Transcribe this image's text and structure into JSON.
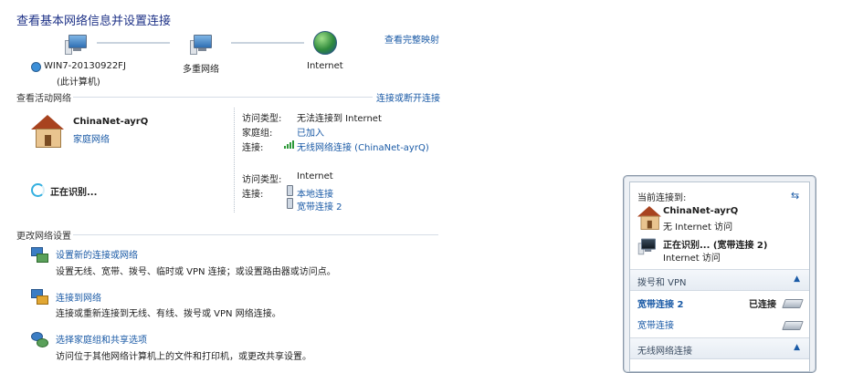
{
  "header": {
    "title": "查看基本网络信息并设置连接",
    "full_map_link": "查看完整映射"
  },
  "map": {
    "computer_name": "WIN7-20130922FJ",
    "computer_sub": "(此计算机)",
    "middle_label": "多重网络",
    "right_label": "Internet"
  },
  "active": {
    "section_title": "查看活动网络",
    "connect_link": "连接或断开连接",
    "net1": {
      "name": "ChinaNet-ayrQ",
      "type": "家庭网络",
      "rows": [
        {
          "label": "访问类型:",
          "value": "无法连接到 Internet"
        },
        {
          "label": "家庭组:",
          "value": "已加入"
        },
        {
          "label": "连接:",
          "value": "无线网络连接 (ChinaNet-ayrQ)"
        }
      ]
    },
    "net2": {
      "name": "正在识别...",
      "rows": [
        {
          "label": "访问类型:",
          "value": "Internet"
        },
        {
          "label": "连接:",
          "value": "本地连接"
        },
        {
          "label": "",
          "value": "宽带连接 2"
        }
      ]
    }
  },
  "settings": {
    "section_title": "更改网络设置",
    "items": [
      {
        "title": "设置新的连接或网络",
        "desc": "设置无线、宽带、拨号、临时或 VPN 连接；或设置路由器或访问点。"
      },
      {
        "title": "连接到网络",
        "desc": "连接或重新连接到无线、有线、拨号或 VPN 网络连接。"
      },
      {
        "title": "选择家庭组和共享选项",
        "desc": "访问位于其他网络计算机上的文件和打印机，或更改共享设置。"
      }
    ]
  },
  "popup": {
    "current_label": "当前连接到:",
    "net1_name": "ChinaNet-ayrQ",
    "net1_status": "无 Internet 访问",
    "net2_name": "正在识别... (宽带连接 2)",
    "net2_status": "Internet 访问",
    "dialup_section": "拨号和 VPN",
    "dialup_items": [
      {
        "name": "宽带连接 2",
        "status": "已连接"
      },
      {
        "name": "宽带连接",
        "status": ""
      }
    ],
    "wireless_section": "无线网络连接"
  }
}
